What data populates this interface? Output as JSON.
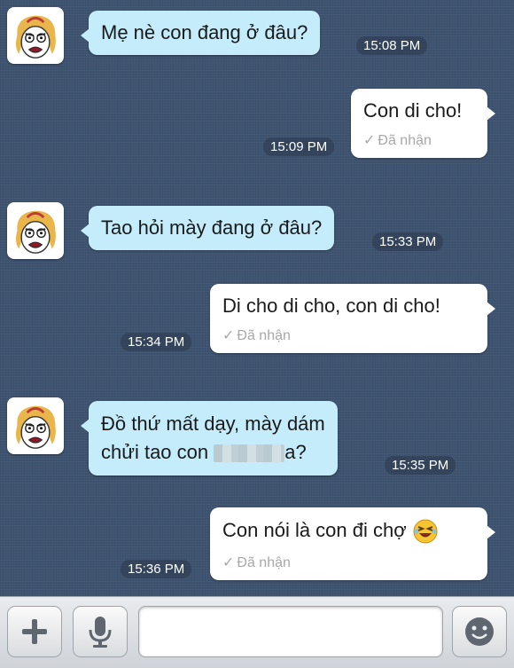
{
  "messages": [
    {
      "text": "Mẹ nè con đang ở đâu?",
      "time": "15:08 PM"
    },
    {
      "text": "Con di cho!",
      "time": "15:09 PM",
      "status": "Đã nhận"
    },
    {
      "text": "Tao hỏi mày đang ở đâu?",
      "time": "15:33 PM"
    },
    {
      "text": "Di cho di cho, con di cho!",
      "time": "15:34 PM",
      "status": "Đã nhận"
    },
    {
      "line1": "Đồ thứ mất dạy, mày dám",
      "line2_start": "chửi tao con",
      "line2_end": "a?",
      "time": "15:35 PM"
    },
    {
      "text": "Con nói là con đi chợ",
      "time": "15:36 PM",
      "status": "Đã nhận"
    }
  ],
  "status_check": "✓",
  "toolbar": {
    "add_icon": "plus-icon",
    "mic_icon": "microphone-icon",
    "emoji_icon": "smiley-icon",
    "input_value": ""
  },
  "colors": {
    "background": "#3e5370",
    "incoming_bubble": "#c4ecfb",
    "outgoing_bubble": "#ffffff",
    "status_text": "#a8a8a8"
  }
}
